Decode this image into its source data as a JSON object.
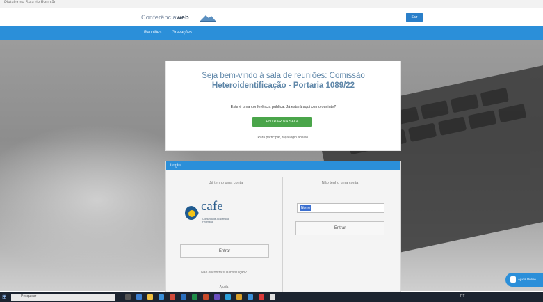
{
  "browser": {
    "title": "Plataforma Sala de Reunião"
  },
  "header": {
    "brand_light": "Conferência",
    "brand_bold": "web",
    "button_label": "Sair"
  },
  "nav": {
    "items": [
      {
        "label": "Reuniões"
      },
      {
        "label": "Gravações"
      }
    ]
  },
  "welcome": {
    "title_line1": "Seja bem-vindo à sala de reuniões: Comissão",
    "title_line2": "Heteroidentificação - Portaria 1089/22",
    "subtitle": "Esta é uma conferência pública. Já estará aqui como ouvinte?",
    "button_label": "ENTRAR NA SALA",
    "note": "Para participar, faça login abaixo."
  },
  "login": {
    "header": "Login",
    "left_title": "Já tenho uma conta",
    "right_title": "Não tenho uma conta",
    "cafe_name": "cafe",
    "cafe_tagline": "Comunidade Acadêmica Federada",
    "left_button": "Entrar",
    "right_field_value": "Nome",
    "right_button": "Entrar",
    "forgot_link": "Não encontra sua instituição?",
    "help_link": "Ajuda"
  },
  "chat": {
    "label": "Ajuda Online"
  },
  "taskbar": {
    "search_placeholder": "Pesquisar",
    "tray_text": "PT"
  }
}
